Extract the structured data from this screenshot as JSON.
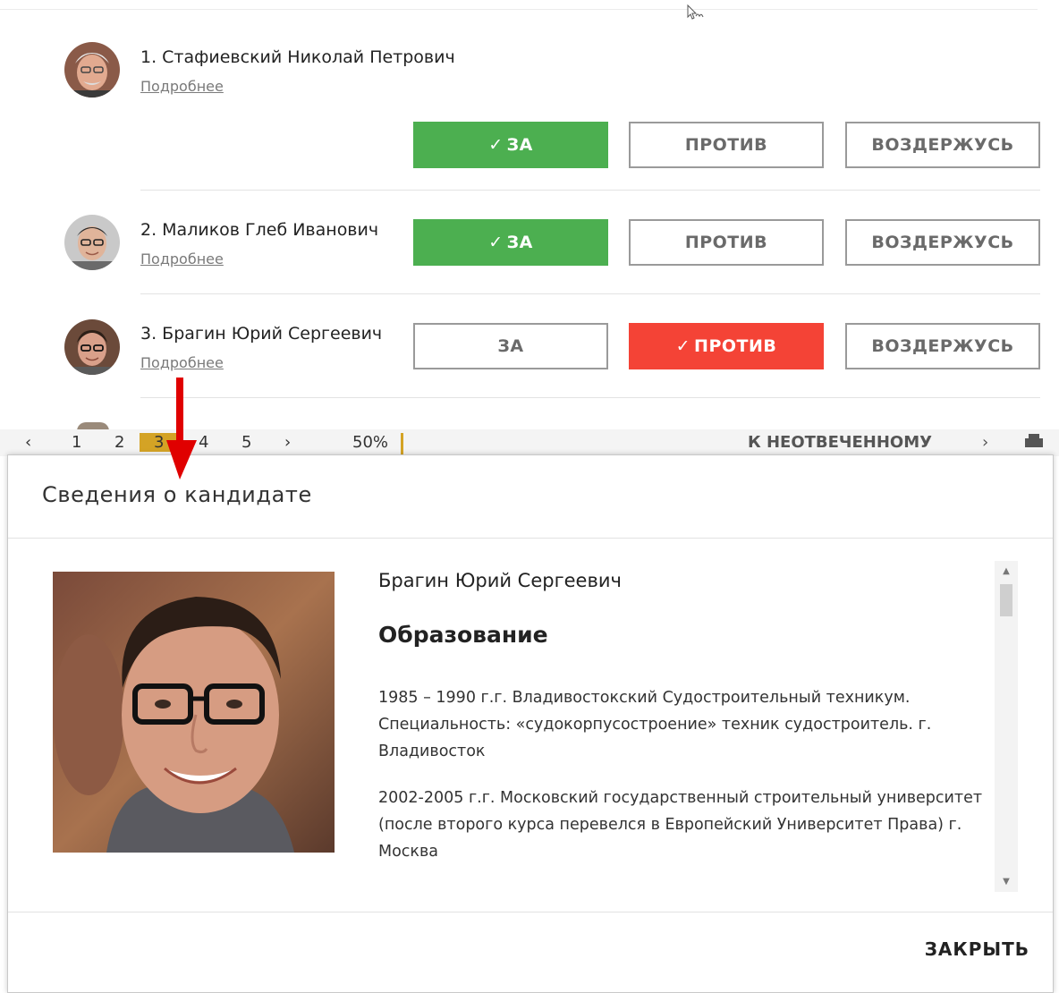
{
  "candidates": [
    {
      "name": "1. Стафиевский Николай Петрович",
      "details_link": "Подробнее",
      "vote_for": "ЗА",
      "vote_against": "ПРОТИВ",
      "vote_abstain": "ВОЗДЕРЖУСЬ",
      "selected": "for"
    },
    {
      "name": "2. Маликов Глеб Иванович",
      "details_link": "Подробнее",
      "vote_for": "ЗА",
      "vote_against": "ПРОТИВ",
      "vote_abstain": "ВОЗДЕРЖУСЬ",
      "selected": "for"
    },
    {
      "name": "3. Брагин Юрий Сергеевич",
      "details_link": "Подробнее",
      "vote_for": "ЗА",
      "vote_against": "ПРОТИВ",
      "vote_abstain": "ВОЗДЕРЖУСЬ",
      "selected": "against"
    }
  ],
  "pager": {
    "pages": [
      "1",
      "2",
      "3",
      "4",
      "5"
    ],
    "active_page": "3",
    "progress": "50%",
    "unanswered_link": "К НЕОТВЕЧЕННОМУ"
  },
  "modal": {
    "title": "Сведения о кандидате",
    "candidate_name": "Брагин Юрий Сергеевич",
    "section_heading": "Образование",
    "paragraphs": [
      "1985 – 1990 г.г. Владивостокский Судостроительный техникум. Специальность: «судокорпусостроение» техник судостроитель. г. Владивосток",
      "2002-2005 г.г. Московский государственный строительный университет (после второго курса перевелся в Европейский Университет Права) г. Москва"
    ],
    "close_label": "ЗАКРЫТЬ"
  },
  "icons": {
    "check": "check-icon",
    "arrow": "red-down-arrow",
    "cursor": "mouse-cursor-icon"
  },
  "colors": {
    "vote_for_selected": "#4caf50",
    "vote_against_selected": "#f44336",
    "annotation_arrow": "#e00000",
    "pager_active": "#d4a325"
  }
}
